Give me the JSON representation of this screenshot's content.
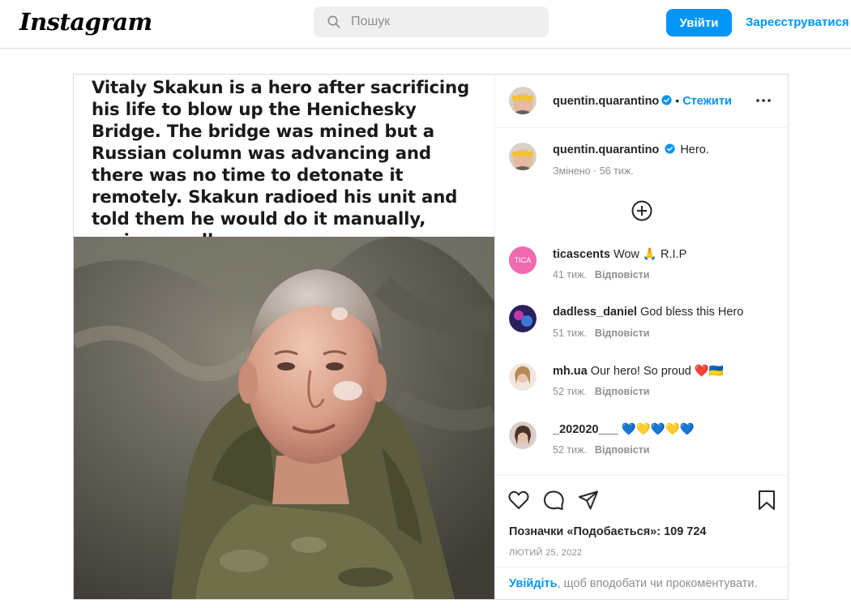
{
  "nav": {
    "logo": "Instagram",
    "search_placeholder": "Пошук",
    "login": "Увійти",
    "signup": "Зареєструватися"
  },
  "post": {
    "image_caption": "Vitaly Skakun is a hero after sacrificing his life to blow up the Henichesky Bridge. The bridge was mined but a Russian column was advancing and there was no time to detonate it remotely. Skakun radioed his unit and told them he would do it manually, saying goodbye.",
    "author": "quentin.quarantino",
    "follow": "Стежити",
    "caption": "Hero.",
    "caption_meta": "Змінено · 56 тиж.",
    "reply_label": "Відповісти",
    "comments": [
      {
        "user": "ticascents",
        "text": "Wow 🙏 R.I.P",
        "age": "41 тиж."
      },
      {
        "user": "dadless_daniel",
        "text": "God bless this Hero",
        "age": "51 тиж."
      },
      {
        "user": "mh.ua",
        "text": "Our hero! So proud ❤️🇺🇦",
        "age": "52 тиж."
      },
      {
        "user": "_202020___",
        "text": "💙💛💙💛💙",
        "age": "52 тиж."
      }
    ],
    "likes": "Позначки «Подобається»: 109 724",
    "date": "ЛЮТИЙ 25, 2022",
    "login_prompt_link": "Увійдіть",
    "login_prompt_rest": ", щоб вподобати чи прокоментувати."
  },
  "colors": {
    "accent": "#0095f6",
    "border": "#dbdbdb",
    "muted": "#8e8e8e"
  }
}
